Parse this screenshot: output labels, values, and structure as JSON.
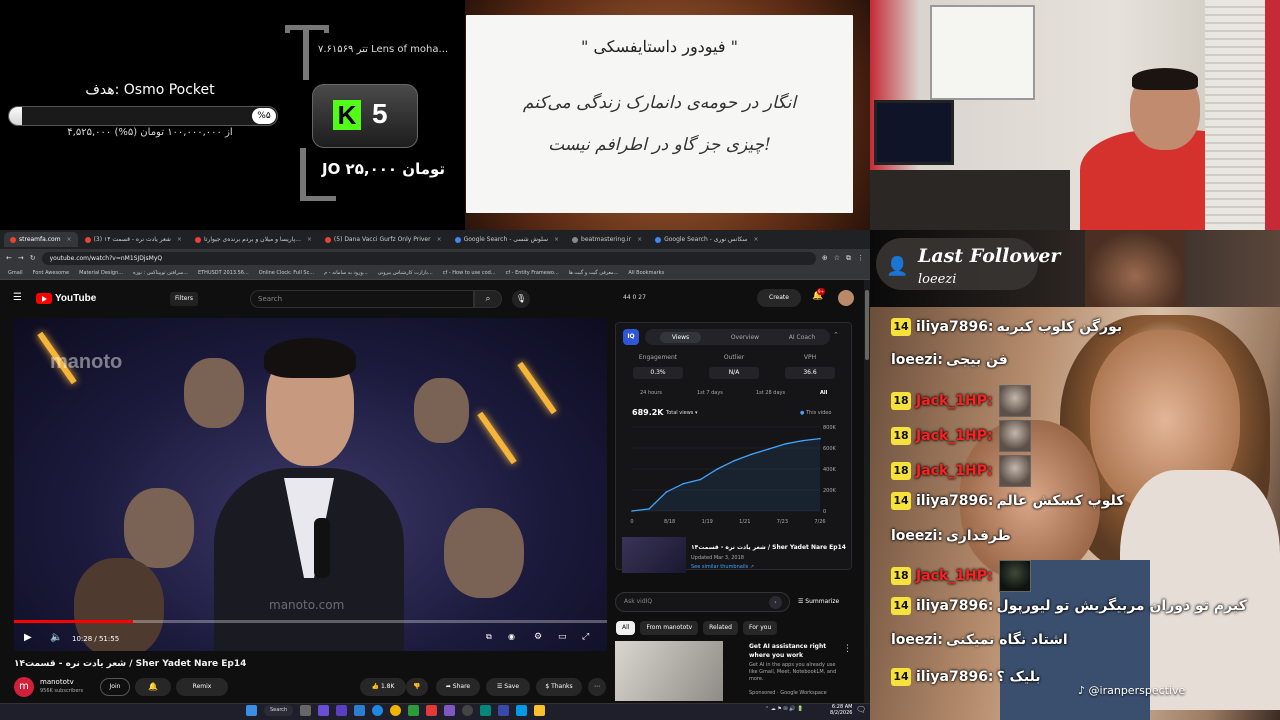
{
  "goal": {
    "title": "هدف: Osmo Pocket",
    "percent_label": "%۵",
    "progress": 0.05,
    "subtitle": "۴,۵۲۵,۰۰۰ از ۱۰۰,۰۰۰,۰۰۰ تومان (۵%)"
  },
  "ticker": "۷.۶۱۵۶۹ تتر  Lens of moha...",
  "kick": {
    "letter": "K",
    "count": "5"
  },
  "tip_amount": "JO ۲۵,۰۰۰ تومان",
  "quote": {
    "title": "\" فیودور داستایفسکی \"",
    "line1": "انگار در حومه‌ی دانمارک زندگی می‌کنم",
    "line2": "چیزی جز گاو در اطرافم نیست!"
  },
  "browser": {
    "tabs": [
      {
        "label": "streamfa.com",
        "active": true
      },
      {
        "label": "شعر یادت نره - قسمت ۱۴ (3)",
        "active": false
      },
      {
        "label": "پاریسا و میلان و بردم برنده‌ی جیوارتا...",
        "active": false
      },
      {
        "label": "(5) Dana Vacci Gurfz Only Priver",
        "active": false
      },
      {
        "label": "Google Search - سلوش شسی",
        "active": false
      },
      {
        "label": "beatmastering.ir",
        "active": false
      },
      {
        "label": "Google Search - سکانس نوری",
        "active": false
      }
    ],
    "url": "youtube.com/watch?v=nM1SJDjsMyQ",
    "bookmarks": [
      "Gmail",
      "Font Awesome",
      "Material Design...",
      "سرافتن توپیتاکس : نوزه...",
      "ETHUSDT 2013.56...",
      "Online Clock: Full Sc...",
      "ورود به سامانه - م...",
      "بازارت کارشناس بیرونی...",
      "cf - How to use cod...",
      "cf - Entity Framewo...",
      "معرفی گیت و گیت ها...",
      "All Bookmarks"
    ]
  },
  "youtube": {
    "logo": "YouTube",
    "filters": "Filters",
    "search_placeholder": "Search",
    "stats": "44  0  27",
    "create": "Create",
    "notif_badge": "9+",
    "video": {
      "watermark": "manoto",
      "overlay_logo": "manoto.com",
      "time": "10:28 / 51:55",
      "progress": 0.2
    },
    "title": "شعر یادت نره - قسمت۱۴ / Sher Yadet Nare Ep14",
    "channel": {
      "name": "manototv",
      "subs": "956K subscribers",
      "avatar_letter": "m"
    },
    "join": "Join",
    "remix": "Remix",
    "likes": "1.8K",
    "share": "Share",
    "save": "Save",
    "thanks": "Thanks"
  },
  "vidiq": {
    "logo": "IQ",
    "tabs": [
      "Views",
      "Overview",
      "AI Coach"
    ],
    "metrics": [
      {
        "label": "Engagement",
        "value": "0.3%"
      },
      {
        "label": "Outlier",
        "value": "N/A"
      },
      {
        "label": "VPH",
        "value": "36.6"
      }
    ],
    "periods": [
      "24 hours",
      "1st 7 days",
      "1st 28 days",
      "All"
    ],
    "total": "689.2K",
    "total_label": "Total views",
    "legend": "This video",
    "video_title": "شعر یادت نره - قسمت۱۴ / Sher Yadet Nare Ep14",
    "video_date": "Updated Mar 3, 2018",
    "video_link": "See similar thumbnails ↗",
    "ask_placeholder": "Ask vidIQ",
    "summarize": "Summarize"
  },
  "chart_data": {
    "type": "line",
    "x_ticks": [
      "0",
      "8/18",
      "1/19",
      "1/21",
      "7/23",
      "7/26"
    ],
    "y_ticks": [
      "0",
      "200K",
      "400K",
      "600K",
      "800K"
    ],
    "ylim": [
      0,
      800000
    ],
    "series": [
      {
        "name": "This video",
        "values": [
          0,
          20000,
          180000,
          260000,
          300000,
          400000,
          480000,
          540000,
          590000,
          640000,
          670000,
          689200
        ]
      }
    ]
  },
  "recommend": {
    "chips": [
      "All",
      "From manototv",
      "Related",
      "For you"
    ],
    "title": "Get AI assistance right where you work",
    "desc": "Get AI in the apps you already use like Gmail, Meet, NotebookLM, and more.",
    "sponsor": "Sponsored · Google Workspace"
  },
  "taskbar": {
    "search": "Search",
    "clock_time": "6:28 AM",
    "clock_date": "8/2/2026"
  },
  "last_follower": {
    "title": "Last Follower",
    "name": "loeezi"
  },
  "chat": [
    {
      "badge": "14",
      "user": "iliya7896:",
      "msg": "بورگن کلوب کبریه",
      "type": "iliya"
    },
    {
      "badge": "",
      "user": "loeezi:",
      "msg": "فن بیجی",
      "type": "loeezi"
    },
    {
      "badge": "18",
      "user": "Jack_1HP:",
      "msg": "",
      "type": "jack",
      "emote": "face"
    },
    {
      "badge": "18",
      "user": "Jack_1HP:",
      "msg": "",
      "type": "jack",
      "emote": "face"
    },
    {
      "badge": "18",
      "user": "Jack_1HP:",
      "msg": "",
      "type": "jack",
      "emote": "face"
    },
    {
      "badge": "14",
      "user": "iliya7896:",
      "msg": "کلوپ کسکش عالم",
      "type": "iliya"
    },
    {
      "badge": "",
      "user": "loeezi:",
      "msg": "طرفداری",
      "type": "loeezi"
    },
    {
      "badge": "18",
      "user": "Jack_1HP:",
      "msg": "",
      "type": "jack",
      "emote": "dark"
    },
    {
      "badge": "14",
      "user": "iliya7896:",
      "msg": "کیرم تو دوران مربیگریش تو لیورپول",
      "type": "iliya"
    },
    {
      "badge": "",
      "user": "loeezi:",
      "msg": "اشتاد نگاه نمیکنی",
      "type": "loeezi"
    },
    {
      "badge": "14",
      "user": "iliya7896:",
      "msg": "بلیک ؟",
      "type": "iliya"
    }
  ],
  "tiktok_handle": "@iranperspective",
  "colors": {
    "kick_green": "#53fc18",
    "yt_red": "#ff0000",
    "badge_yellow": "#f6e23a",
    "jack_red": "#ff2020"
  }
}
